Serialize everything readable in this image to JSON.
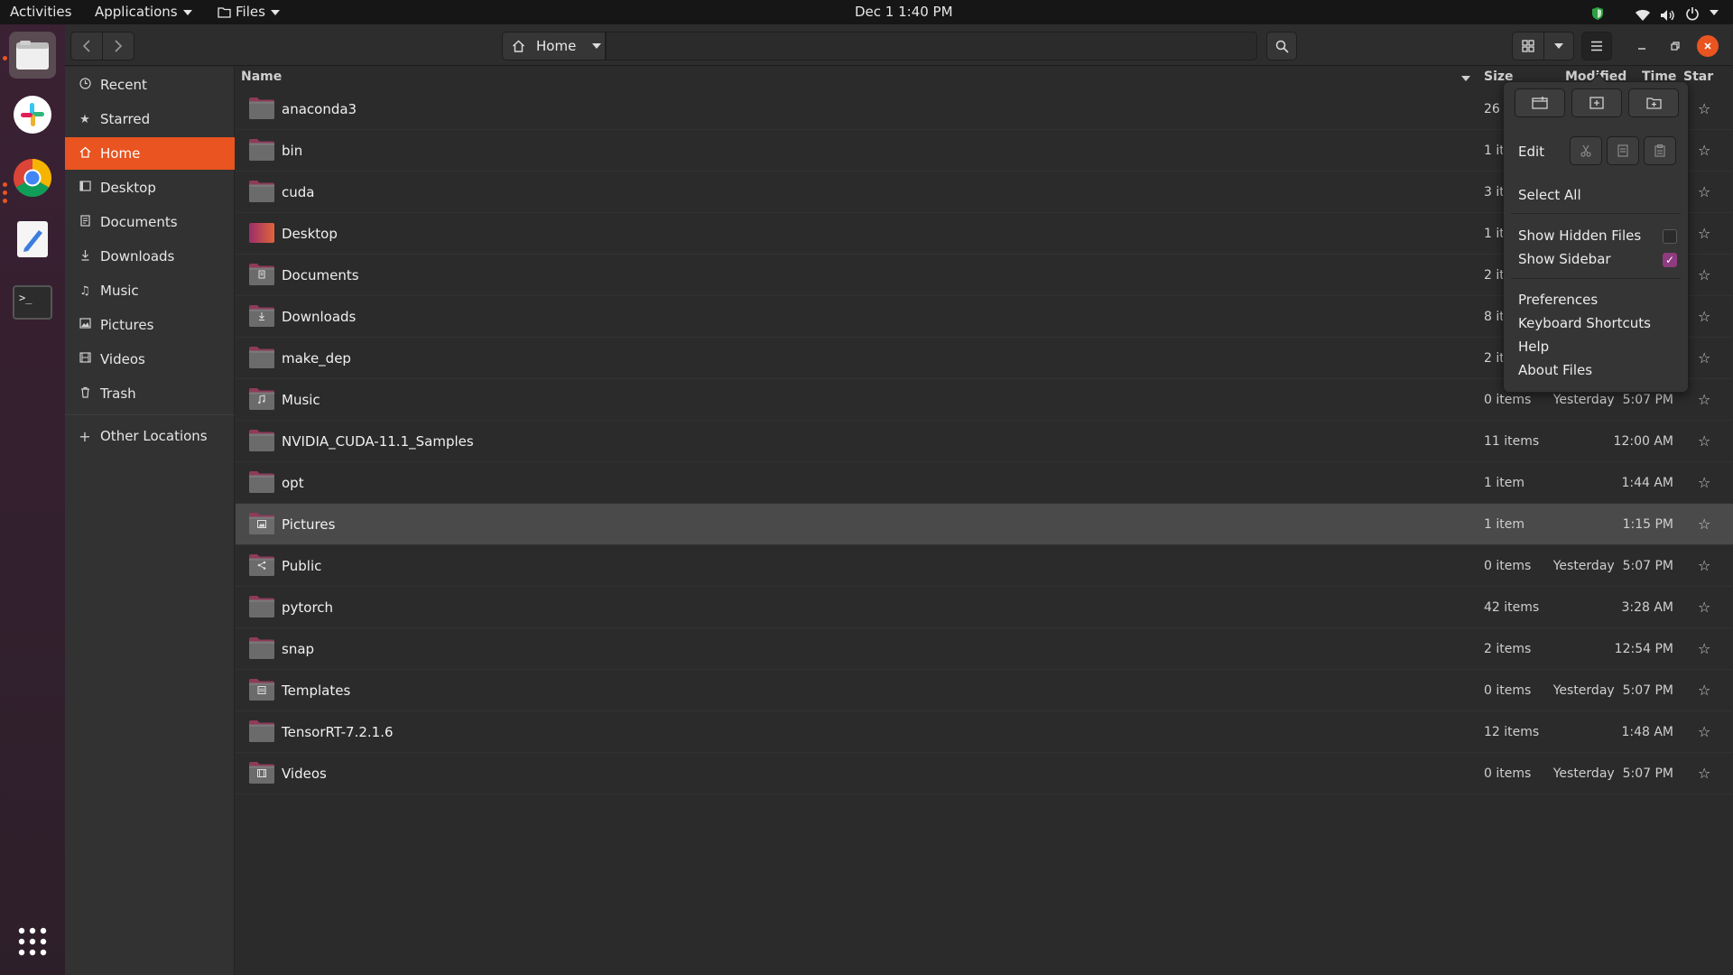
{
  "topbar": {
    "activities": "Activities",
    "applications": "Applications",
    "files_menu": "Files",
    "clock": "Dec 1  1:40 PM"
  },
  "dock": {
    "apps": [
      "files-icon",
      "slack-icon",
      "chrome-icon",
      "text-editor-icon",
      "terminal-icon"
    ],
    "terminal_glyph": ">_",
    "show_apps": "show-applications-icon"
  },
  "headerbar": {
    "location_label": "Home",
    "window_buttons": [
      "minimize",
      "maximize",
      "close"
    ]
  },
  "sidebar": {
    "items": [
      {
        "label": "Recent",
        "icon": "clock-icon"
      },
      {
        "label": "Starred",
        "icon": "star-icon"
      },
      {
        "label": "Home",
        "icon": "home-icon",
        "active": true
      },
      {
        "label": "Desktop",
        "icon": "desktop-icon"
      },
      {
        "label": "Documents",
        "icon": "document-icon"
      },
      {
        "label": "Downloads",
        "icon": "download-icon"
      },
      {
        "label": "Music",
        "icon": "music-icon"
      },
      {
        "label": "Pictures",
        "icon": "picture-icon"
      },
      {
        "label": "Videos",
        "icon": "video-icon"
      },
      {
        "label": "Trash",
        "icon": "trash-icon"
      },
      {
        "label": "Other Locations",
        "icon": "plus-icon"
      }
    ]
  },
  "columns": {
    "name": "Name",
    "size": "Size",
    "modified": "Modified",
    "time": "Time",
    "star": "Star"
  },
  "files": [
    {
      "name": "anaconda3",
      "size": "26",
      "modified": "",
      "type": "plain"
    },
    {
      "name": "bin",
      "size": "1 it",
      "modified": "",
      "type": "plain"
    },
    {
      "name": "cuda",
      "size": "3 it",
      "modified": "",
      "type": "plain"
    },
    {
      "name": "Desktop",
      "size": "1 it",
      "modified": "",
      "type": "desktop"
    },
    {
      "name": "Documents",
      "size": "2 it",
      "modified": "",
      "type": "documents"
    },
    {
      "name": "Downloads",
      "size": "8 it",
      "modified": "",
      "type": "downloads"
    },
    {
      "name": "make_dep",
      "size": "2 it",
      "modified": "",
      "type": "plain"
    },
    {
      "name": "Music",
      "size": "0 items",
      "modified": "Yesterday  5:07 PM",
      "type": "music"
    },
    {
      "name": "NVIDIA_CUDA-11.1_Samples",
      "size": "11 items",
      "modified": "12:00 AM",
      "type": "plain"
    },
    {
      "name": "opt",
      "size": "1 item",
      "modified": "1:44 AM",
      "type": "plain"
    },
    {
      "name": "Pictures",
      "size": "1 item",
      "modified": "1:15 PM",
      "type": "pictures",
      "selected": true
    },
    {
      "name": "Public",
      "size": "0 items",
      "modified": "Yesterday  5:07 PM",
      "type": "public"
    },
    {
      "name": "pytorch",
      "size": "42 items",
      "modified": "3:28 AM",
      "type": "plain"
    },
    {
      "name": "snap",
      "size": "2 items",
      "modified": "12:54 PM",
      "type": "plain"
    },
    {
      "name": "Templates",
      "size": "0 items",
      "modified": "Yesterday  5:07 PM",
      "type": "templates"
    },
    {
      "name": "TensorRT-7.2.1.6",
      "size": "12 items",
      "modified": "1:48 AM",
      "type": "plain"
    },
    {
      "name": "Videos",
      "size": "0 items",
      "modified": "Yesterday  5:07 PM",
      "type": "videos"
    }
  ],
  "popover": {
    "top_buttons": [
      "new-window-icon",
      "new-tab-icon",
      "new-folder-icon"
    ],
    "edit_label": "Edit",
    "edit_buttons": [
      "cut-icon",
      "copy-icon",
      "paste-icon"
    ],
    "select_all": "Select All",
    "show_hidden": {
      "label": "Show Hidden Files",
      "checked": false
    },
    "show_sidebar": {
      "label": "Show Sidebar",
      "checked": true
    },
    "preferences": "Preferences",
    "keyboard_shortcuts": "Keyboard Shortcuts",
    "help": "Help",
    "about": "About Files"
  },
  "colors": {
    "accent": "#e95420",
    "folder": "#8e3b5a",
    "checkbox_on": "#8e3b7f"
  }
}
